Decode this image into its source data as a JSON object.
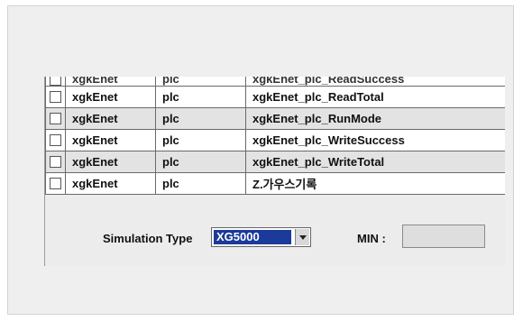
{
  "table": {
    "partial_row": {
      "name": "xgkEnet",
      "type": "plc",
      "tag": "xgkEnet_plc_ReadSuccess"
    },
    "rows": [
      {
        "name": "xgkEnet",
        "type": "plc",
        "tag": "xgkEnet_plc_ReadTotal"
      },
      {
        "name": "xgkEnet",
        "type": "plc",
        "tag": "xgkEnet_plc_RunMode"
      },
      {
        "name": "xgkEnet",
        "type": "plc",
        "tag": "xgkEnet_plc_WriteSuccess"
      },
      {
        "name": "xgkEnet",
        "type": "plc",
        "tag": "xgkEnet_plc_WriteTotal"
      },
      {
        "name": "xgkEnet",
        "type": "plc",
        "tag": "Z.가우스기록"
      }
    ]
  },
  "simulation": {
    "label": "Simulation Type",
    "selected": "XG5000"
  },
  "min": {
    "label": "MIN :",
    "value": ""
  }
}
